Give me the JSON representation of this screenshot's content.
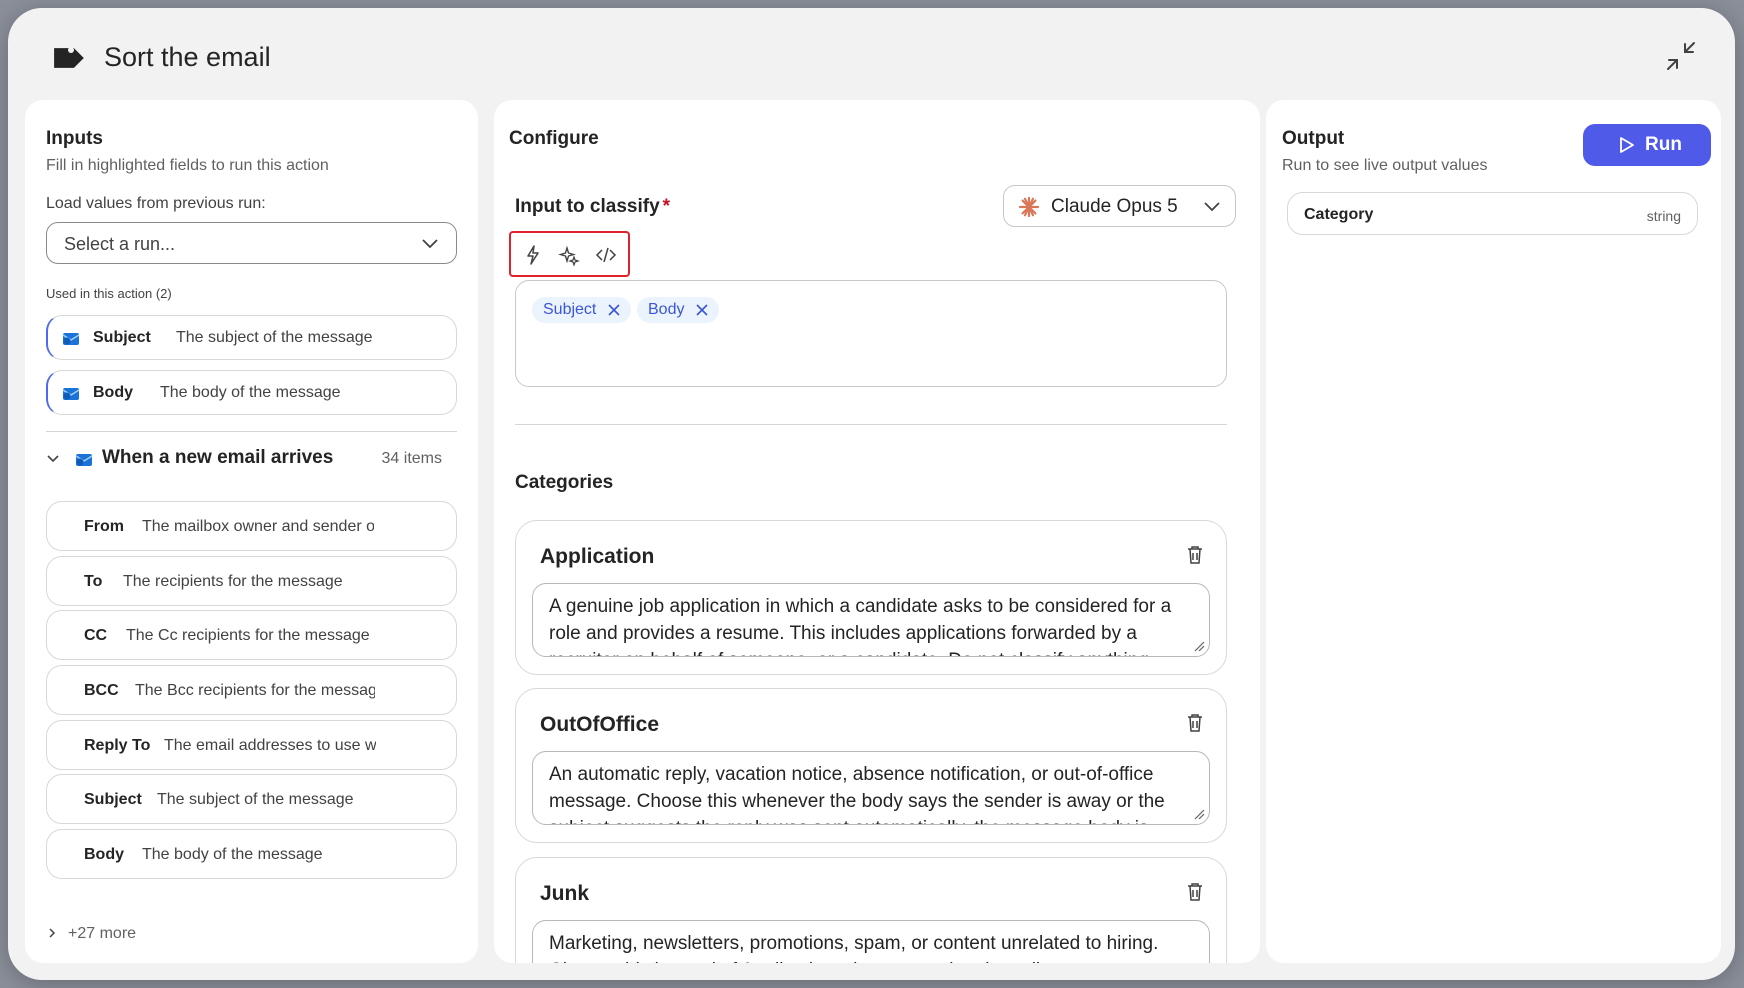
{
  "header": {
    "title": "Sort the email"
  },
  "inputs": {
    "title": "Inputs",
    "subtitle": "Fill in highlighted fields to run this action",
    "load_label": "Load values from previous run:",
    "select_placeholder": "Select a run...",
    "used_label": "Used in this action (2)",
    "used_fields": [
      {
        "name": "Subject",
        "desc": "The subject of the message"
      },
      {
        "name": "Body",
        "desc": "The body of the message"
      }
    ],
    "trigger": {
      "name": "When a new email arrives",
      "count": "34 items"
    },
    "trigger_fields": [
      {
        "name": "From",
        "desc": "The mailbox owner and sender o"
      },
      {
        "name": "To",
        "desc": "The recipients for the message"
      },
      {
        "name": "CC",
        "desc": "The Cc recipients for the message"
      },
      {
        "name": "BCC",
        "desc": "The Bcc recipients for the messag"
      },
      {
        "name": "Reply To",
        "desc": "The email addresses to use w"
      },
      {
        "name": "Subject",
        "desc": "The subject of the message"
      },
      {
        "name": "Body",
        "desc": "The body of the message"
      }
    ],
    "more": "+27 more"
  },
  "configure": {
    "title": "Configure",
    "input_label": "Input to classify",
    "required_mark": "*",
    "model": "Claude Opus 5",
    "tokens": [
      "Subject",
      "Body"
    ],
    "categories_title": "Categories",
    "categories": [
      {
        "name": "Application",
        "desc": "A genuine job application in which a candidate asks to be considered for a role and provides a resume. This includes applications forwarded by a recruiter on behalf of someone, or a candidate. Do not classify anything else as an application."
      },
      {
        "name": "OutOfOffice",
        "desc": "An automatic reply, vacation notice, absence notification, or out-of-office message. Choose this whenever the body says the sender is away or the subject suggests the reply was sent automatically, the message body is brief."
      },
      {
        "name": "Junk",
        "desc": "Marketing, newsletters, promotions, spam, or content unrelated to hiring. Choose this instead of Application when promotional wording appears, even if a job is mentioned."
      }
    ]
  },
  "output": {
    "title": "Output",
    "subtitle": "Run to see live output values",
    "run_label": "Run",
    "field_name": "Category",
    "field_type": "string"
  },
  "colors": {
    "accent": "#4f5ae8",
    "highlight_border": "#e0212e",
    "token_bg": "#ebf3fc",
    "token_text": "#3b56d6"
  }
}
